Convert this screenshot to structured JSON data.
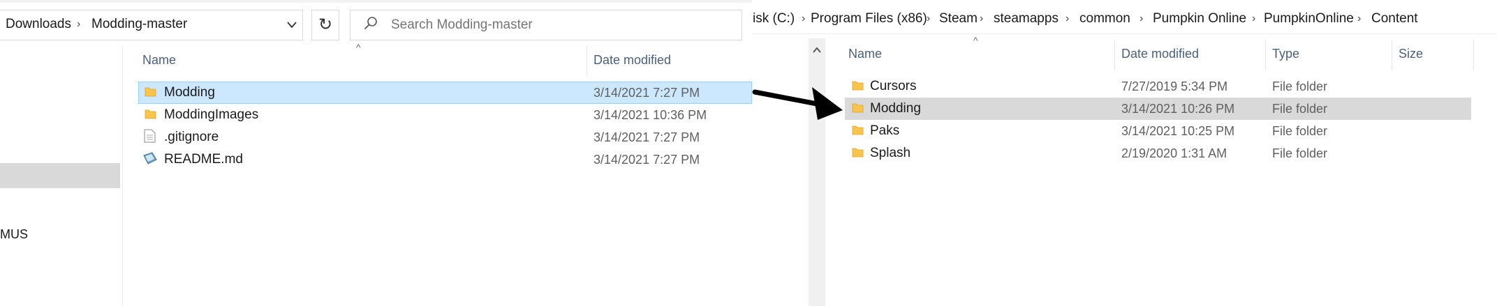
{
  "left": {
    "breadcrumb": [
      "Downloads",
      "Modding-master"
    ],
    "search": {
      "placeholder": "Search Modding-master"
    },
    "nav": {
      "partial_item": "MUS"
    },
    "columns": {
      "name": "Name",
      "date": "Date modified"
    },
    "files": [
      {
        "name": "Modding",
        "date": "3/14/2021 7:27 PM",
        "icon": "folder-icon",
        "selected": true
      },
      {
        "name": "ModdingImages",
        "date": "3/14/2021 10:36 PM",
        "icon": "folder-icon",
        "selected": false
      },
      {
        "name": ".gitignore",
        "date": "3/14/2021 7:27 PM",
        "icon": "text-file-icon",
        "selected": false
      },
      {
        "name": "README.md",
        "date": "3/14/2021 7:27 PM",
        "icon": "markdown-file-icon",
        "selected": false
      }
    ]
  },
  "right": {
    "breadcrumb": [
      "isk (C:)",
      "Program Files (x86)",
      "Steam",
      "steamapps",
      "common",
      "Pumpkin Online",
      "PumpkinOnline",
      "Content"
    ],
    "columns": {
      "name": "Name",
      "date": "Date modified",
      "type": "Type",
      "size": "Size"
    },
    "files": [
      {
        "name": "Cursors",
        "date": "7/27/2019 5:34 PM",
        "type": "File folder",
        "selected": false
      },
      {
        "name": "Modding",
        "date": "3/14/2021 10:26 PM",
        "type": "File folder",
        "selected": true
      },
      {
        "name": "Paks",
        "date": "3/14/2021 10:25 PM",
        "type": "File folder",
        "selected": false
      },
      {
        "name": "Splash",
        "date": "2/19/2020 1:31 AM",
        "type": "File folder",
        "selected": false
      }
    ]
  },
  "colors": {
    "selection_left": "#cce8ff",
    "selection_right": "#d9d9d9",
    "folder": "#f8c44a",
    "header_text": "#4c607a"
  }
}
